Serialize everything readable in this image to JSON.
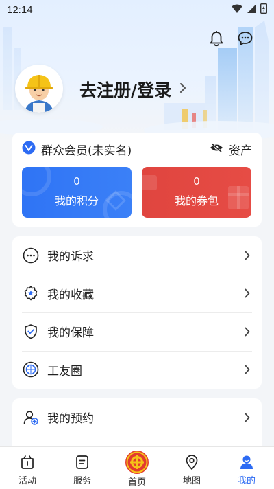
{
  "status_bar": {
    "time": "12:14"
  },
  "header": {
    "icons": [
      "bell-icon",
      "message-icon"
    ]
  },
  "profile": {
    "register_label": "去注册/登录"
  },
  "member": {
    "name": "群众会员(未实名)",
    "assets_label": "资产",
    "points": {
      "value": "0",
      "label": "我的积分"
    },
    "coupons": {
      "value": "0",
      "label": "我的券包"
    }
  },
  "menu_group_1": [
    {
      "label": "我的诉求",
      "icon": "chat-bubble-icon"
    },
    {
      "label": "我的收藏",
      "icon": "star-badge-icon"
    },
    {
      "label": "我的保障",
      "icon": "shield-check-icon"
    },
    {
      "label": "工友圈",
      "icon": "circle-icon"
    }
  ],
  "menu_group_2": [
    {
      "label": "我的预约",
      "icon": "person-add-icon"
    }
  ],
  "bottom_nav": [
    {
      "label": "活动",
      "icon": "activity-icon"
    },
    {
      "label": "服务",
      "icon": "service-icon"
    },
    {
      "label": "首页",
      "icon": "home-emblem-icon"
    },
    {
      "label": "地图",
      "icon": "map-pin-icon"
    },
    {
      "label": "我的",
      "icon": "user-icon",
      "active": true
    }
  ],
  "colors": {
    "accent": "#2d6bf3",
    "points_tile": "#2f74f5",
    "coupons_tile": "#e0453f",
    "background": "#f3f5f8"
  }
}
